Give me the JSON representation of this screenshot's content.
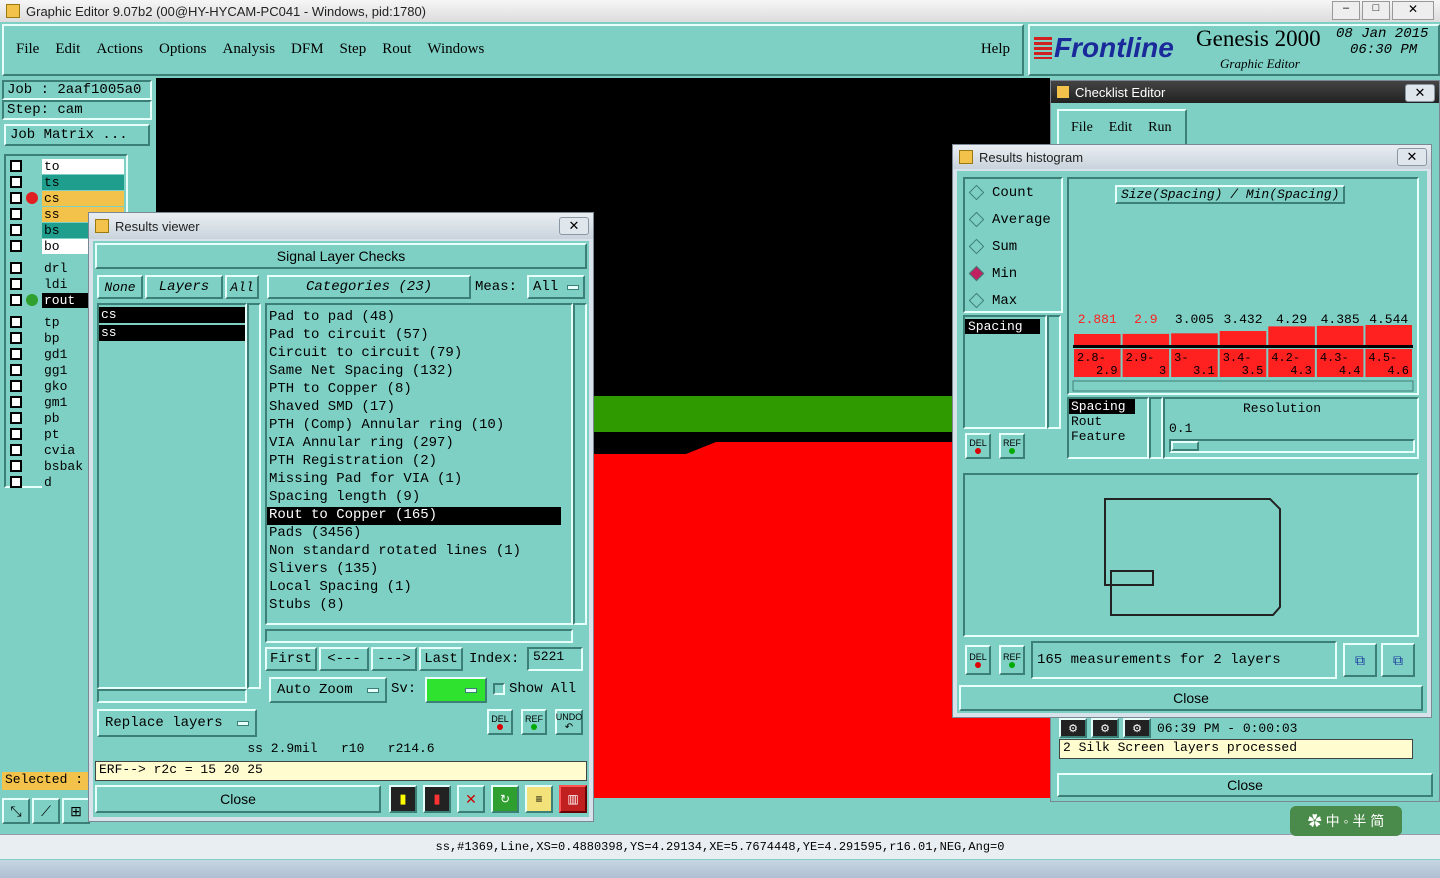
{
  "app": {
    "title": "Graphic Editor 9.07b2 (00@HY-HYCAM-PC041 - Windows, pid:1780)",
    "menu": [
      "File",
      "Edit",
      "Actions",
      "Options",
      "Analysis",
      "DFM",
      "Step",
      "Rout",
      "Windows"
    ],
    "help": "Help",
    "brand": "Frontline",
    "product": "Genesis 2000",
    "subtitle": "Graphic Editor",
    "date": "08 Jan 2015",
    "time": "06:30 PM"
  },
  "job": {
    "job": "Job : 2aaf1005a0",
    "step": "Step: cam",
    "matrix_btn": "Job Matrix ..."
  },
  "layers": {
    "group1": [
      "to",
      "ts",
      "cs",
      "ss",
      "bs",
      "bo"
    ],
    "group2": [
      "drl",
      "ldi",
      "rout"
    ],
    "group3": [
      "tp",
      "bp",
      "gd1",
      "gg1",
      "gko",
      "gm1",
      "pb",
      "pt",
      "cvia",
      "bsbak",
      "d"
    ]
  },
  "selected_label": "Selected :",
  "status_line": "ss,#1369,Line,XS=0.4880398,YS=4.29134,XE=5.7674448,YE=4.291595,r16.01,NEG,Ang=0",
  "results_viewer": {
    "title": "Results viewer",
    "header": "Signal Layer Checks",
    "btn_none": "None",
    "btn_layers": "Layers",
    "btn_all": "All",
    "categories_btn": "Categories (23)",
    "meas_label": "Meas:",
    "meas_value": "All",
    "layer_list": [
      "cs",
      "ss"
    ],
    "categories": [
      "Pad to pad (48)",
      "Pad to circuit (57)",
      "Circuit to circuit (79)",
      "Same Net Spacing (132)",
      "PTH to Copper (8)",
      "Shaved SMD (17)",
      "PTH (Comp) Annular ring (10)",
      "VIA Annular ring (297)",
      "PTH Registration (2)",
      "Missing Pad for VIA (1)",
      "Spacing length (9)",
      "Rout to Copper (165)",
      "Pads (3456)",
      "Non standard rotated lines (1)",
      "Slivers (135)",
      "Local Spacing (1)",
      "Stubs (8)"
    ],
    "selected_index": 11,
    "nav": {
      "first": "First",
      "prev": "<---",
      "next": "--->",
      "last": "Last",
      "index_label": "Index:",
      "index_value": "5221"
    },
    "auto_zoom": "Auto Zoom",
    "sv_label": "Sv:",
    "show_all": "Show All",
    "replace_layers": "Replace layers",
    "del": "DEL",
    "ref": "REF",
    "undo": "UNDO",
    "info_line": "ss 2.9mil   r10   r214.6",
    "erf_line": "ERF--> r2c = 15 20 25",
    "close": "Close"
  },
  "checklist": {
    "title": "Checklist Editor",
    "menu": [
      "File",
      "Edit",
      "Run"
    ],
    "progress_time": "06:39 PM - 0:00:03",
    "message": "2 Silk Screen layers processed",
    "close": "Close"
  },
  "histogram": {
    "title": "Results histogram",
    "modes": [
      "Count",
      "Average",
      "Sum",
      "Min",
      "Max"
    ],
    "selected_mode": "Min",
    "chart_title": "Size(Spacing) / Min(Spacing)",
    "list": [
      "Spacing"
    ],
    "types": [
      "Spacing",
      "Rout",
      "Feature"
    ],
    "resolution_label": "Resolution",
    "resolution_value": "0.1",
    "summary": "165 measurements for 2 layers",
    "del": "DEL",
    "ref": "REF",
    "close": "Close"
  },
  "chart_data": {
    "type": "bar",
    "title": "Size(Spacing) / Min(Spacing)",
    "categories": [
      "2.8-2.9",
      "2.9-3",
      "3-3.1",
      "3.4-3.5",
      "4.2-4.3",
      "4.3-4.4",
      "4.5-4.6"
    ],
    "values": [
      2.881,
      2.9,
      3.005,
      3.432,
      4.29,
      4.385,
      4.544
    ],
    "highlight_first": 2,
    "colors": {
      "bar": "#ff2020",
      "label_hot": "#ff2020",
      "label": "#000000"
    }
  },
  "colors": {
    "panel": "#7fd0c4",
    "canvas": "#000000",
    "copper": "#ff0000",
    "green_track": "#2f9a00",
    "selected": "#000000"
  }
}
